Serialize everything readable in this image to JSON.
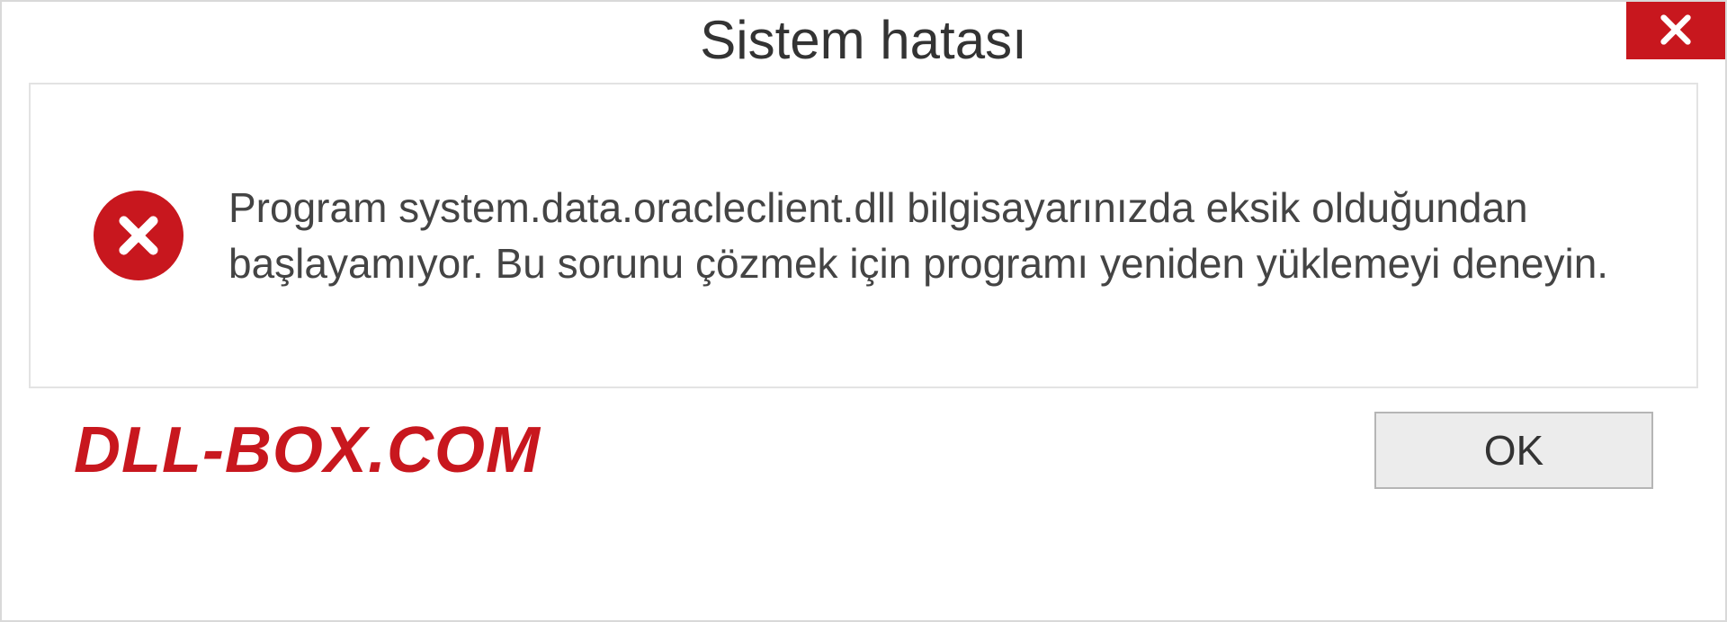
{
  "dialog": {
    "title": "Sistem hatası",
    "message": "Program system.data.oracleclient.dll bilgisayarınızda eksik olduğundan başlayamıyor. Bu sorunu çözmek için programı yeniden yüklemeyi deneyin.",
    "ok_label": "OK"
  },
  "watermark": "DLL-BOX.COM",
  "colors": {
    "error_red": "#c8171e",
    "border_gray": "#d9d9d9",
    "button_gray": "#ececec"
  }
}
